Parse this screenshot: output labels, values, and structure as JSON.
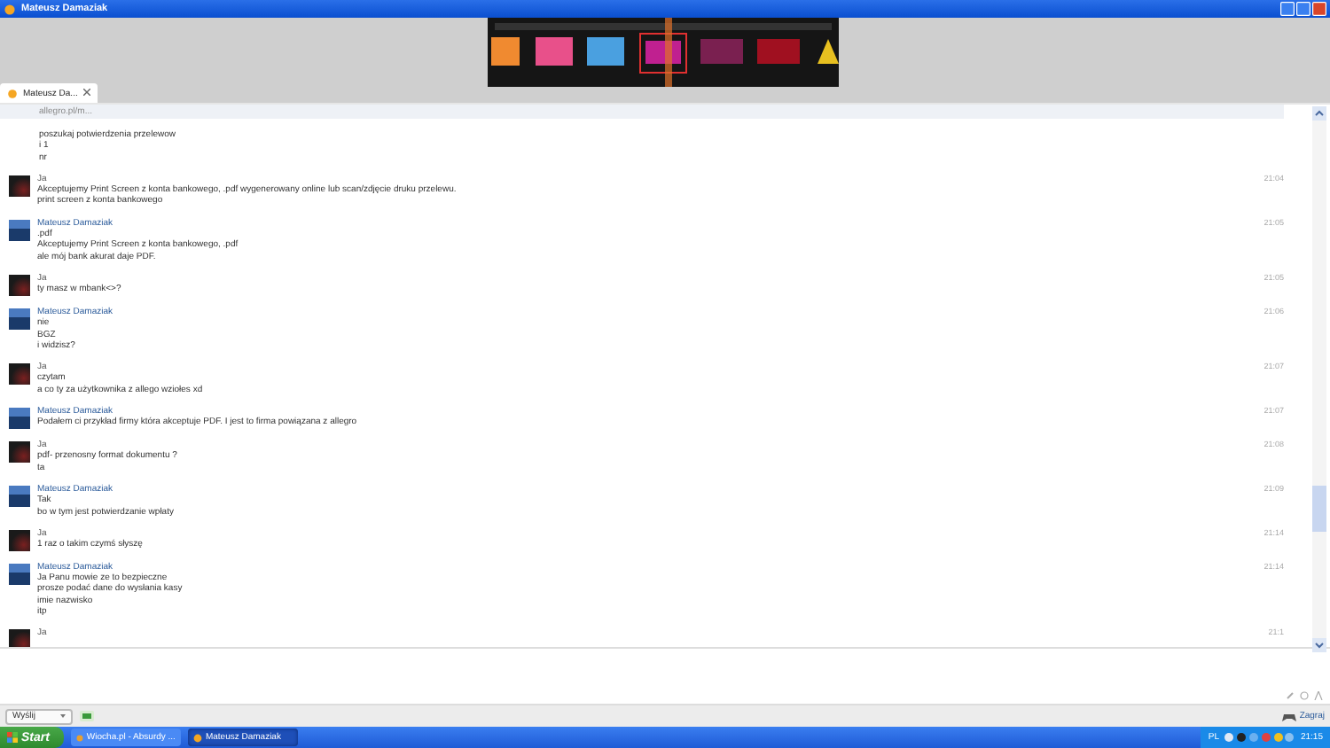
{
  "window": {
    "title": "Mateusz Damaziak"
  },
  "tab": {
    "label": "Mateusz Da...",
    "selected": true
  },
  "chat": {
    "preview": {
      "link": "allegro.pl/m...",
      "lines": [
        "poszukaj potwierdzenia przelewow",
        "i 1",
        "nr"
      ]
    },
    "messages": [
      {
        "author": "Ja",
        "kind": "self",
        "time": "21:04",
        "lines": [
          "Akceptujemy Print Screen z konta bankowego, .pdf wygenerowany online lub scan/zdjęcie druku przelewu.",
          "print screen z konta bankowego"
        ]
      },
      {
        "author": "Mateusz Damaziak",
        "kind": "contact",
        "time": "21:05",
        "lines": [
          ".pdf",
          "Akceptujemy Print Screen z konta bankowego, .pdf",
          "ale mój bank akurat daje PDF."
        ]
      },
      {
        "author": "Ja",
        "kind": "self",
        "time": "21:05",
        "lines": [
          "ty masz w mbank<>?"
        ]
      },
      {
        "author": "Mateusz Damaziak",
        "kind": "contact",
        "time": "21:06",
        "lines": [
          "nie",
          "BGZ",
          "i widzisz?"
        ]
      },
      {
        "author": "Ja",
        "kind": "self",
        "time": "21:07",
        "lines": [
          "czytam",
          "a co ty za użytkownika z allego wziołes xd"
        ]
      },
      {
        "author": "Mateusz Damaziak",
        "kind": "contact",
        "time": "21:07",
        "lines": [
          "Podałem ci przykład firmy która akceptuje PDF. I jest to firma powiązana z allegro"
        ]
      },
      {
        "author": "Ja",
        "kind": "self",
        "time": "21:08",
        "lines": [
          "pdf- przenosny format dokumentu ?",
          "ta"
        ]
      },
      {
        "author": "Mateusz Damaziak",
        "kind": "contact",
        "time": "21:09",
        "lines": [
          "Tak",
          "bo w tym jest potwierdzanie wpłaty"
        ]
      },
      {
        "author": "Ja",
        "kind": "self",
        "time": "21:14",
        "lines": [
          "1 raz o takim czymś słyszę"
        ]
      },
      {
        "author": "Mateusz Damaziak",
        "kind": "contact",
        "time": "21:14",
        "lines": [
          "Ja Panu mowie ze to bezpieczne",
          "prosze podać dane do wysłania kasy",
          "imie nazwisko",
          "itp"
        ]
      },
      {
        "author": "Ja",
        "kind": "self",
        "time": "21:1"
      }
    ]
  },
  "composer": {
    "send_button": "Wyślij",
    "game_link": "Zagraj"
  },
  "taskbar": {
    "start": "Start",
    "tasks": [
      {
        "label": "Wiocha.pl - Absurdy ...",
        "selected": false
      },
      {
        "label": "Mateusz Damaziak",
        "selected": true
      }
    ],
    "language": "PL",
    "clock": "21:15"
  }
}
